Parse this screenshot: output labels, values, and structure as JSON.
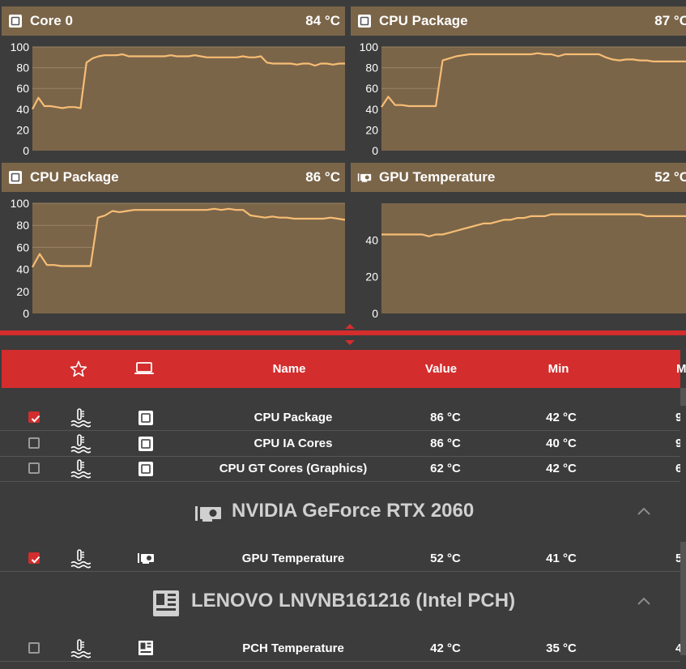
{
  "colors": {
    "accent": "#d32d2d",
    "panel_header": "#7b6549",
    "plot_fill": "#7b6549",
    "plot_line": "#f7bd74",
    "background": "#3c3c3c"
  },
  "charts": [
    {
      "title": "Core 0",
      "value": "84 °C",
      "icon": "cpu-chip-icon"
    },
    {
      "title": "CPU Package",
      "value": "87 °C",
      "icon": "cpu-chip-icon"
    },
    {
      "title": "CPU Package",
      "value": "86 °C",
      "icon": "cpu-chip-icon"
    },
    {
      "title": "GPU Temperature",
      "value": "52 °C",
      "icon": "gpu-card-icon"
    }
  ],
  "chart_data": [
    {
      "type": "area",
      "title": "Core 0",
      "xlabel": "",
      "ylabel": "",
      "ylim": [
        0,
        100
      ],
      "yticks": [
        "100",
        "80",
        "60",
        "40",
        "20",
        "0"
      ],
      "series": [
        {
          "values": [
            40,
            51,
            43,
            43,
            42,
            41,
            42,
            42,
            41,
            85,
            89,
            91,
            92,
            92,
            92,
            93,
            91,
            91,
            91,
            91,
            91,
            91,
            91,
            92,
            91,
            91,
            91,
            92,
            91,
            90,
            90,
            90,
            90,
            90,
            90,
            91,
            90,
            90,
            91,
            85,
            84,
            84,
            84,
            84,
            83,
            84,
            84,
            82,
            84,
            84,
            83,
            84,
            84
          ]
        }
      ]
    },
    {
      "type": "area",
      "title": "CPU Package",
      "xlabel": "",
      "ylabel": "",
      "ylim": [
        0,
        100
      ],
      "yticks": [
        "100",
        "80",
        "60",
        "40",
        "20",
        "0"
      ],
      "series": [
        {
          "values": [
            42,
            52,
            44,
            44,
            43,
            43,
            43,
            43,
            43,
            87,
            89,
            91,
            92,
            93,
            93,
            93,
            93,
            93,
            93,
            93,
            93,
            93,
            93,
            94,
            93,
            93,
            91,
            93,
            93,
            93,
            93,
            93,
            93,
            90,
            88,
            87,
            88,
            88,
            87,
            87,
            86,
            86,
            86,
            86,
            86,
            86,
            86
          ]
        }
      ]
    },
    {
      "type": "area",
      "title": "CPU Package",
      "xlabel": "",
      "ylabel": "",
      "ylim": [
        0,
        100
      ],
      "yticks": [
        "100",
        "80",
        "60",
        "40",
        "20",
        "0"
      ],
      "series": [
        {
          "values": [
            42,
            54,
            44,
            44,
            43,
            43,
            43,
            43,
            43,
            87,
            89,
            93,
            92,
            93,
            94,
            94,
            94,
            94,
            94,
            94,
            94,
            94,
            94,
            94,
            94,
            95,
            94,
            95,
            94,
            94,
            89,
            88,
            87,
            88,
            87,
            87,
            86,
            86,
            86,
            86,
            86,
            87,
            86,
            85
          ]
        }
      ]
    },
    {
      "type": "area",
      "title": "GPU Temperature",
      "xlabel": "",
      "ylabel": "",
      "ylim": [
        0,
        60
      ],
      "yticks": [
        "40",
        "20",
        "0"
      ],
      "series": [
        {
          "values": [
            43,
            43,
            43,
            43,
            43,
            43,
            43,
            42,
            43,
            43,
            44,
            45,
            46,
            47,
            48,
            49,
            49,
            50,
            51,
            51,
            52,
            52,
            53,
            53,
            53,
            54,
            54,
            54,
            54,
            54,
            54,
            54,
            54,
            54,
            54,
            54,
            54,
            54,
            54,
            53,
            53,
            53,
            53,
            53,
            53,
            53,
            53
          ]
        }
      ]
    }
  ],
  "table": {
    "columns": {
      "name": "Name",
      "value": "Value",
      "min": "Min",
      "max_partial": "M"
    },
    "groups": [
      {
        "title": "NVIDIA GeForce RTX 2060",
        "icon": "gpu-card-icon"
      },
      {
        "title": "LENOVO LNVNB161216 (Intel PCH)",
        "icon": "motherboard-icon"
      }
    ],
    "rows": [
      {
        "name": "CPU Package",
        "value": "86 °C",
        "min": "42 °C",
        "max_partial": "9",
        "checked": true,
        "device_icon": "cpu-chip-icon"
      },
      {
        "name": "CPU IA Cores",
        "value": "86 °C",
        "min": "40 °C",
        "max_partial": "9",
        "checked": false,
        "device_icon": "cpu-chip-icon"
      },
      {
        "name": "CPU GT Cores (Graphics)",
        "value": "62 °C",
        "min": "42 °C",
        "max_partial": "6",
        "checked": false,
        "device_icon": "cpu-chip-icon"
      },
      {
        "name": "GPU Temperature",
        "value": "52 °C",
        "min": "41 °C",
        "max_partial": "5",
        "checked": true,
        "device_icon": "gpu-card-icon"
      },
      {
        "name": "PCH Temperature",
        "value": "42 °C",
        "min": "35 °C",
        "max_partial": "4",
        "checked": false,
        "device_icon": "motherboard-icon"
      }
    ]
  }
}
